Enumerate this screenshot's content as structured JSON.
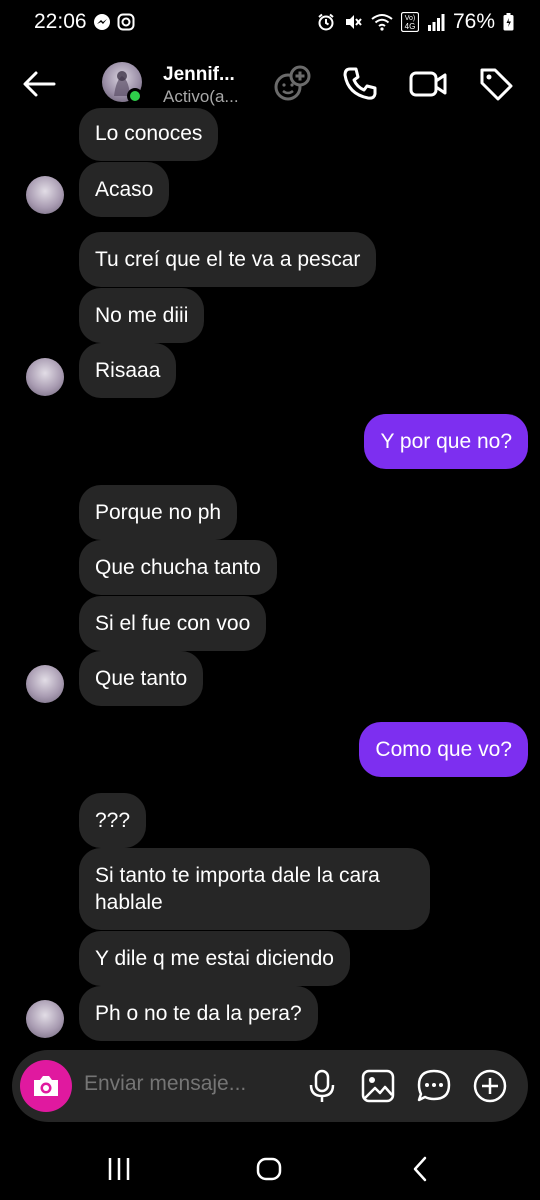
{
  "status_bar": {
    "time": "22:06",
    "battery": "76%",
    "lte_label_top": "Vo)",
    "lte_label_bottom": "4G"
  },
  "header": {
    "contact_name": "Jennif...",
    "contact_status": "Activo(a..."
  },
  "messages": [
    {
      "text": "Lo conoces",
      "direction": "in"
    },
    {
      "text": "Acaso",
      "direction": "in"
    },
    {
      "text": "Tu creí que el te va a pescar",
      "direction": "in"
    },
    {
      "text": "No me diii",
      "direction": "in"
    },
    {
      "text": "Risaaa",
      "direction": "in"
    },
    {
      "text": "Y por que no?",
      "direction": "out"
    },
    {
      "text": "Porque no ph",
      "direction": "in"
    },
    {
      "text": "Que chucha tanto",
      "direction": "in"
    },
    {
      "text": "Si el fue con voo",
      "direction": "in"
    },
    {
      "text": "Que tanto",
      "direction": "in"
    },
    {
      "text": "Como que vo?",
      "direction": "out"
    },
    {
      "text": "???",
      "direction": "in"
    },
    {
      "text": "Si tanto te importa dale la cara\nhablale",
      "direction": "in"
    },
    {
      "text": "Y dile q me estai diciendo",
      "direction": "in"
    },
    {
      "text": "Ph o no te da la pera?",
      "direction": "in"
    }
  ],
  "composer": {
    "placeholder": "Enviar mensaje..."
  },
  "colors": {
    "outgoing_bubble": "#7d2ff0",
    "incoming_bubble": "#262626",
    "camera_button": "#e0199f",
    "online_dot": "#2fcf4b"
  }
}
